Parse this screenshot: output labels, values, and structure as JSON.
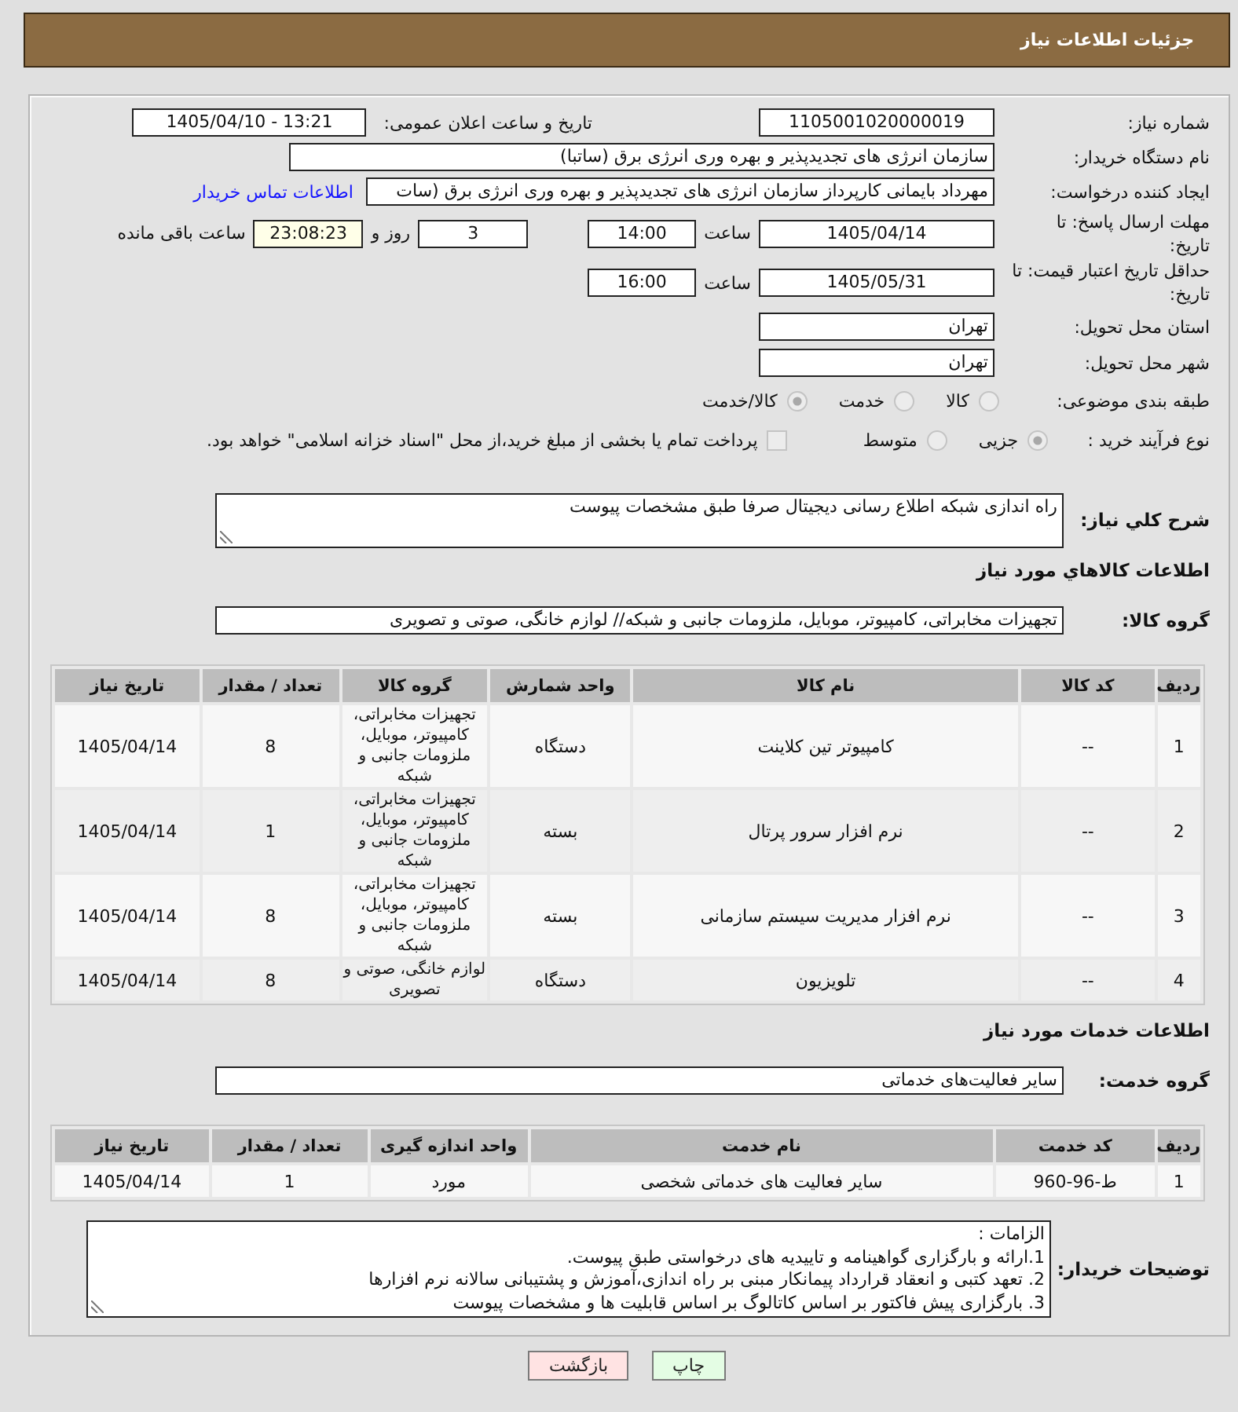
{
  "header": {
    "title": "جزئیات اطلاعات نیاز"
  },
  "details": {
    "need_number": {
      "label": "شماره نیاز:",
      "value": "1105001020000019"
    },
    "announce": {
      "label": "تاریخ و ساعت اعلان عمومی:",
      "value": "1405/04/10 - 13:21"
    },
    "buyer": {
      "label": "نام دستگاه خریدار:",
      "value": "سازمان انرژی های تجدیدپذیر و بهره وری انرژی برق (ساتبا)"
    },
    "requester": {
      "label": "ایجاد کننده درخواست:",
      "value": "مهرداد بایمانی کارپرداز سازمان انرژی های تجدیدپذیر و بهره وری انرژی برق (سات",
      "contact_link": "اطلاعات تماس خریدار"
    },
    "response_deadline": {
      "label": "مهلت ارسال پاسخ: تا تاریخ:",
      "date": "1405/04/14",
      "time_label": "ساعت",
      "time": "14:00",
      "days": "3",
      "days_label": "روز و",
      "remaining": "23:08:23",
      "remaining_label": "ساعت باقی مانده"
    },
    "price_validity": {
      "label": "حداقل تاریخ اعتبار قیمت: تا تاریخ:",
      "date": "1405/05/31",
      "time_label": "ساعت",
      "time": "16:00"
    },
    "delivery_province": {
      "label": "استان محل تحویل:",
      "value": "تهران"
    },
    "delivery_city": {
      "label": "شهر محل تحویل:",
      "value": "تهران"
    },
    "category": {
      "label": "طبقه بندی موضوعی:",
      "options": [
        {
          "label": "کالا",
          "selected": false
        },
        {
          "label": "خدمت",
          "selected": false
        },
        {
          "label": "کالا/خدمت",
          "selected": true
        }
      ]
    },
    "purchase_process": {
      "label": "نوع فرآیند خرید :",
      "options": [
        {
          "label": "جزیی",
          "selected": true
        },
        {
          "label": "متوسط",
          "selected": false
        }
      ],
      "treasury": {
        "label": "پرداخت تمام یا بخشی از مبلغ خرید،از محل \"اسناد خزانه اسلامی\" خواهد بود.",
        "checked": false
      }
    }
  },
  "description": {
    "label": "شرح کلي نياز:",
    "value": "راه اندازی شبکه اطلاع رسانی دیجیتال صرفا طبق مشخصات پیوست"
  },
  "goods": {
    "title": "اطلاعات کالاهاي مورد نياز",
    "group_label": "گروه کالا:",
    "group_value": "تجهیزات مخابراتی، کامپیوتر، موبایل، ملزومات جانبی و شبکه// لوازم خانگی، صوتی و تصویری",
    "columns": [
      "ردیف",
      "کد کالا",
      "نام کالا",
      "واحد شمارش",
      "گروه کالا",
      "تعداد / مقدار",
      "تاریخ نیاز"
    ],
    "rows": [
      {
        "row": "1",
        "code": "--",
        "name": "کامپیوتر تین کلاینت",
        "unit": "دستگاه",
        "group": "تجهیزات مخابراتی، کامپیوتر، موبایل، ملزومات جانبی و شبکه",
        "quantity": "8",
        "date": "1405/04/14"
      },
      {
        "row": "2",
        "code": "--",
        "name": "نرم افزار سرور پرتال",
        "unit": "بسته",
        "group": "تجهیزات مخابراتی، کامپیوتر، موبایل، ملزومات جانبی و شبکه",
        "quantity": "1",
        "date": "1405/04/14"
      },
      {
        "row": "3",
        "code": "--",
        "name": "نرم افزار مدیریت سیستم سازمانی",
        "unit": "بسته",
        "group": "تجهیزات مخابراتی، کامپیوتر، موبایل، ملزومات جانبی و شبکه",
        "quantity": "8",
        "date": "1405/04/14"
      },
      {
        "row": "4",
        "code": "--",
        "name": "تلویزیون",
        "unit": "دستگاه",
        "group": "لوازم خانگی، صوتی و تصویری",
        "quantity": "8",
        "date": "1405/04/14"
      }
    ]
  },
  "services": {
    "title": "اطلاعات خدمات مورد نیاز",
    "group_label": "گروه خدمت:",
    "group_value": "سایر فعالیت‌های خدماتی",
    "columns": [
      "ردیف",
      "کد خدمت",
      "نام خدمت",
      "واحد اندازه گیری",
      "تعداد / مقدار",
      "تاریخ نیاز"
    ],
    "rows": [
      {
        "row": "1",
        "code": "ط-96-960",
        "name": "سایر فعالیت های خدماتی شخصی",
        "unit": "مورد",
        "quantity": "1",
        "date": "1405/04/14"
      }
    ]
  },
  "buyer_notes": {
    "label": "توضیحات خریدار:",
    "lines": [
      "الزامات :",
      "1.ارائه و بارگزاری گواهینامه و تاییدیه های درخواستی طبق پیوست.",
      "2. تعهد کتبی و انعقاد قرارداد پیمانکار مبنی بر راه اندازی،آموزش و پشتیبانی سالانه نرم افزارها",
      "3. بارگزاری پیش فاکتور بر اساس کاتالوگ بر اساس قابلیت ها و مشخصات پیوست"
    ]
  },
  "buttons": [
    {
      "label": "چاپ",
      "kind": "print"
    },
    {
      "label": "بازگشت",
      "kind": "back"
    }
  ]
}
